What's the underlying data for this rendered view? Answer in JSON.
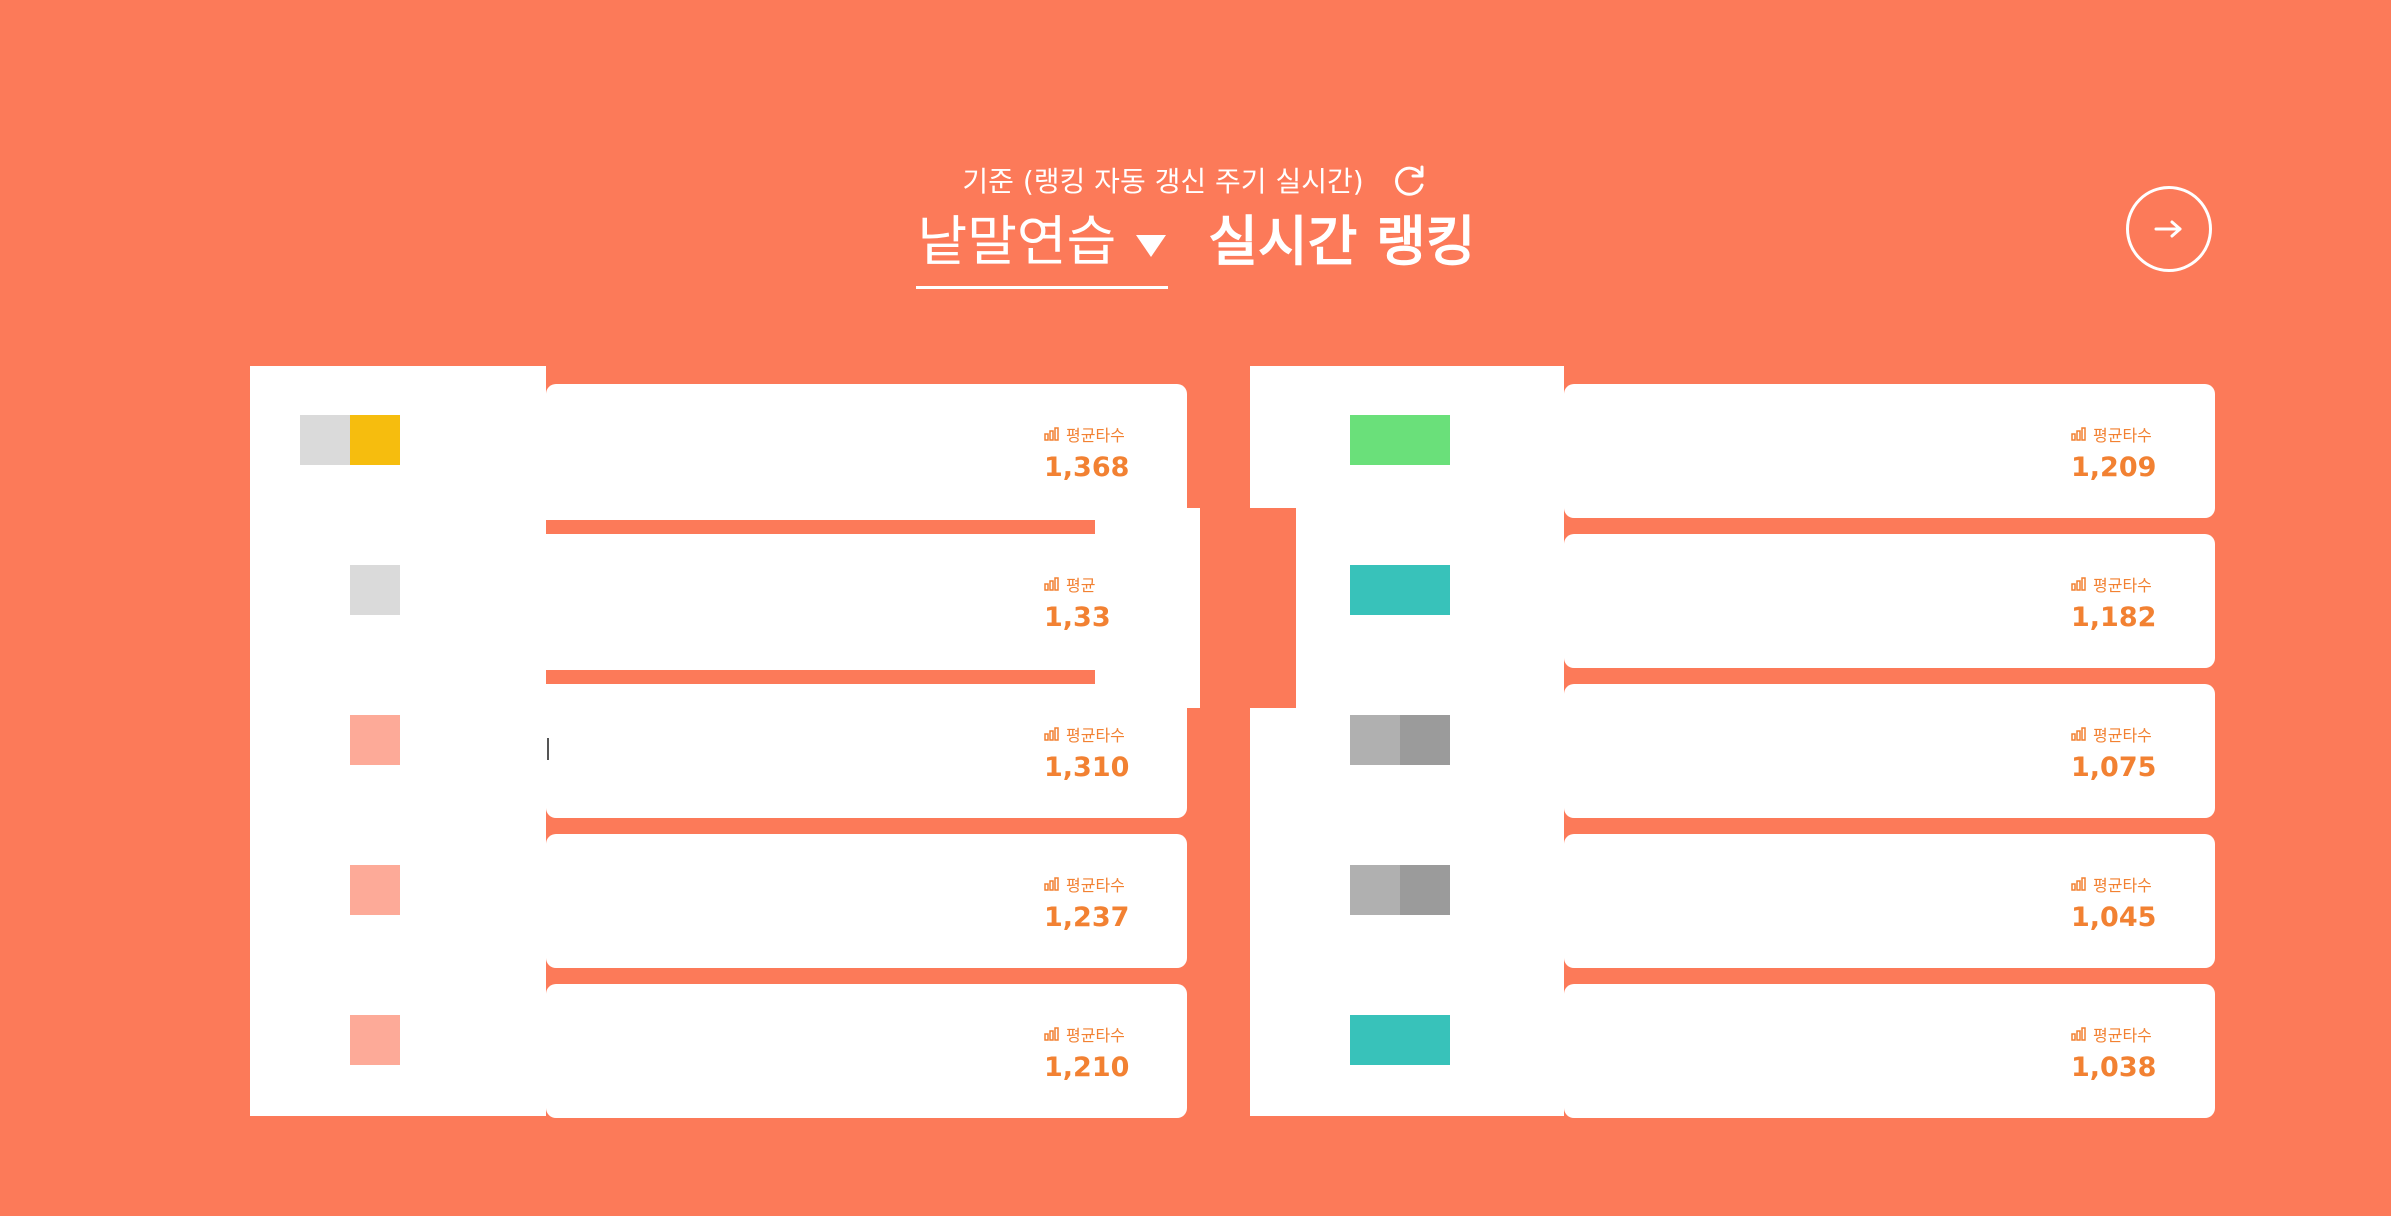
{
  "header": {
    "subtitle": "기준 (랭킹 자동 갱신 주기 실시간)",
    "mode_label": "낱말연습",
    "title": "실시간 랭킹"
  },
  "icons": {
    "refresh": "refresh-icon",
    "next": "arrow-right-icon",
    "stat": "bar-chart-icon",
    "dropdown": "caret-down-icon"
  },
  "colors": {
    "background": "#FC7A59",
    "accent": "#F28132",
    "avatar_gold": "#F6BD0E",
    "avatar_green": "#6AE07A",
    "avatar_teal": "#38C2BA",
    "avatar_salmon": "#FDAA98",
    "avatar_gray": "#9B9B9B",
    "avatar_lightgray": "#DADADA"
  },
  "rankings": {
    "left": [
      {
        "label": "평균타수",
        "value": "1,368"
      },
      {
        "label": "평균",
        "value": "1,33"
      },
      {
        "label": "평균타수",
        "value": "1,310"
      },
      {
        "label": "평균타수",
        "value": "1,237"
      },
      {
        "label": "평균타수",
        "value": "1,210"
      }
    ],
    "right": [
      {
        "label": "평균타수",
        "value": "1,209"
      },
      {
        "label": "평균타수",
        "value": "1,182"
      },
      {
        "label": "평균타수",
        "value": "1,075"
      },
      {
        "label": "평균타수",
        "value": "1,045"
      },
      {
        "label": "평균타수",
        "value": "1,038"
      }
    ]
  }
}
